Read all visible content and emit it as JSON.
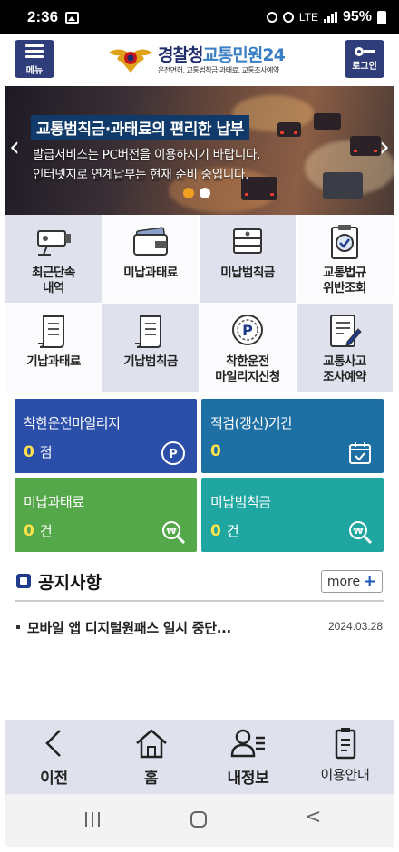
{
  "status_bar": {
    "time": "2:36",
    "network": "LTE",
    "battery": "95%"
  },
  "header": {
    "menu_label": "메뉴",
    "login_label": "로그인",
    "logo_title_main": "경찰청",
    "logo_title_accent": "교통민원24",
    "logo_subtitle": "운전면허, 교통범칙금·과태료, 교통조사예약"
  },
  "banner": {
    "headline": "교통범칙금·과태료의 편리한 납부",
    "line1": "발급서비스는 PC버전을 이용하시기 바랍니다.",
    "line2": "인터넷지로 연계납부는 현재 준비 중입니다.",
    "prev_arrow": "‹",
    "next_arrow": "›",
    "slides_total": 2,
    "active_slide": 1
  },
  "grid_menu": [
    {
      "label": "최근단속\n내역",
      "icon": "cctv-camera-icon"
    },
    {
      "label": "미납과태료",
      "icon": "wallet-icon"
    },
    {
      "label": "미납범칙금",
      "icon": "money-stack-icon"
    },
    {
      "label": "교통법규\n위반조회",
      "icon": "clipboard-check-icon"
    },
    {
      "label": "기납과태료",
      "icon": "receipt-scroll-icon"
    },
    {
      "label": "기납범칙금",
      "icon": "receipt-scroll-icon"
    },
    {
      "label": "착한운전\n마일리지신청",
      "icon": "mileage-p-icon"
    },
    {
      "label": "교통사고\n조사예약",
      "icon": "document-pen-icon"
    }
  ],
  "tiles": [
    {
      "title": "착한운전마일리지",
      "value": "0",
      "unit": "점",
      "icon": "p-coin-icon"
    },
    {
      "title": "적검(갱신)기간",
      "value": "0",
      "unit": "",
      "icon": "calendar-check-icon"
    },
    {
      "title": "미납과태료",
      "value": "0",
      "unit": "건",
      "icon": "won-search-icon"
    },
    {
      "title": "미납범칙금",
      "value": "0",
      "unit": "건",
      "icon": "won-search-icon"
    }
  ],
  "notices": {
    "title": "공지사항",
    "more_label": "more",
    "items": [
      {
        "text": "모바일 앱 디지털원패스 일시 중단...",
        "date": "2024.03.28"
      }
    ]
  },
  "bottom_nav": [
    {
      "label": "이전",
      "icon": "chevron-left-icon"
    },
    {
      "label": "홈",
      "icon": "home-icon"
    },
    {
      "label": "내정보",
      "icon": "user-list-icon"
    },
    {
      "label": "이용안내",
      "icon": "guide-clipboard-icon"
    }
  ],
  "colors": {
    "navy": "#2f3e7a",
    "tile_blue": "#2b4fa8",
    "tile_teal_blue": "#1e6fa4",
    "tile_green": "#55a84a",
    "tile_teal": "#20a6a0",
    "value_yellow": "#ffe14a",
    "dot_active": "#f0a020"
  }
}
